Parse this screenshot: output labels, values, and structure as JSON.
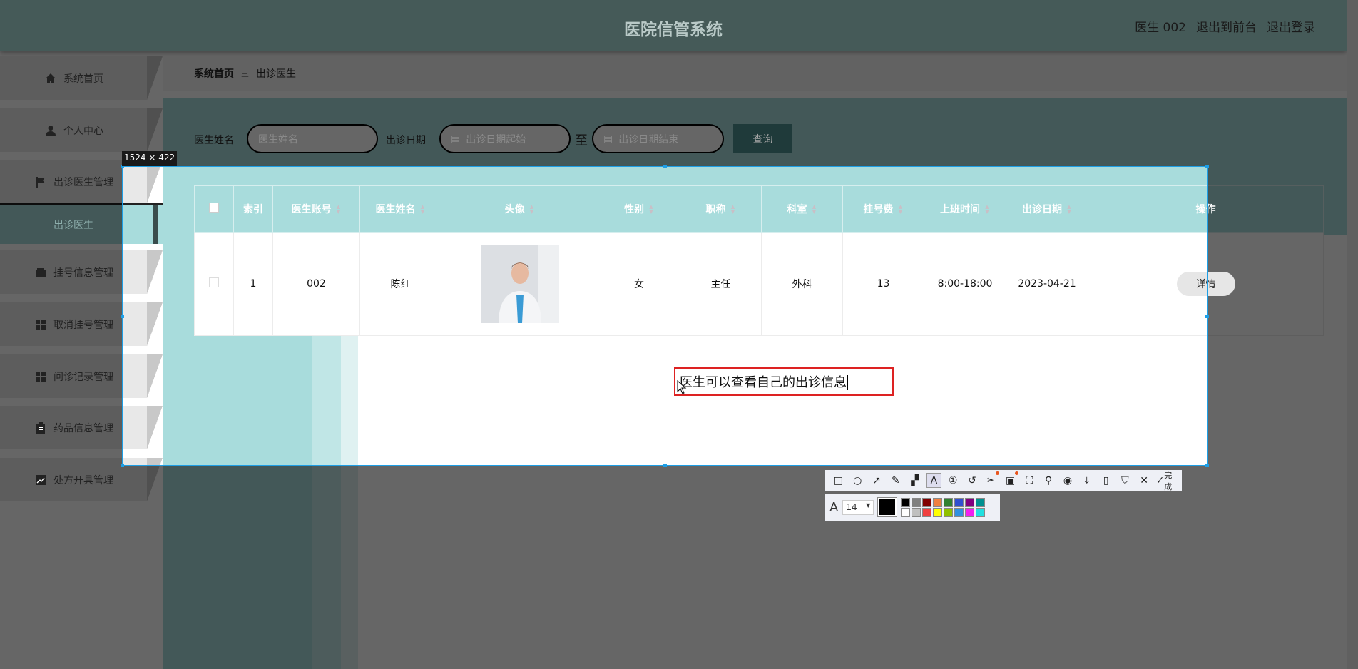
{
  "header": {
    "title": "医院信管系统",
    "user": "医生 002",
    "to_front": "退出到前台",
    "logout": "退出登录"
  },
  "sidebar": {
    "items": [
      {
        "label": "系统首页",
        "icon": "home-icon"
      },
      {
        "label": "个人中心",
        "icon": "user-icon"
      },
      {
        "label": "出诊医生管理",
        "icon": "flag-icon"
      },
      {
        "label": "挂号信息管理",
        "icon": "wallet-icon"
      },
      {
        "label": "取消挂号管理",
        "icon": "grid-icon"
      },
      {
        "label": "问诊记录管理",
        "icon": "grid-icon"
      },
      {
        "label": "药品信息管理",
        "icon": "clipboard-icon"
      },
      {
        "label": "处方开具管理",
        "icon": "chart-icon"
      }
    ],
    "sub_item": "出诊医生"
  },
  "breadcrumb": {
    "home": "系统首页",
    "sep": "三",
    "current": "出诊医生"
  },
  "search": {
    "name_label": "医生姓名",
    "name_placeholder": "医生姓名",
    "date_label": "出诊日期",
    "date_start_placeholder": "出诊日期起始",
    "to": "至",
    "date_end_placeholder": "出诊日期结束",
    "query": "查询"
  },
  "table": {
    "headers": [
      "索引",
      "医生账号",
      "医生姓名",
      "头像",
      "性别",
      "职称",
      "科室",
      "挂号费",
      "上班时间",
      "出诊日期",
      "操作"
    ],
    "rows": [
      {
        "index": "1",
        "account": "002",
        "name": "陈红",
        "gender": "女",
        "title": "主任",
        "dept": "外科",
        "fee": "13",
        "hours": "8:00-18:00",
        "date": "2023-04-21",
        "action": "详情"
      }
    ]
  },
  "screenshot_tool": {
    "size_label": "1524 × 422",
    "annotation": "医生可以查看自己的出诊信息",
    "font_size": "14",
    "done": "完成",
    "palette": [
      "#000000",
      "#808080",
      "#800000",
      "#f08040",
      "#308030",
      "#3050d0",
      "#800080",
      "#009090",
      "#ffffff",
      "#c0c0c0",
      "#f04040",
      "#ffff00",
      "#90c000",
      "#3090e0",
      "#f020f0",
      "#20e0e0"
    ]
  }
}
